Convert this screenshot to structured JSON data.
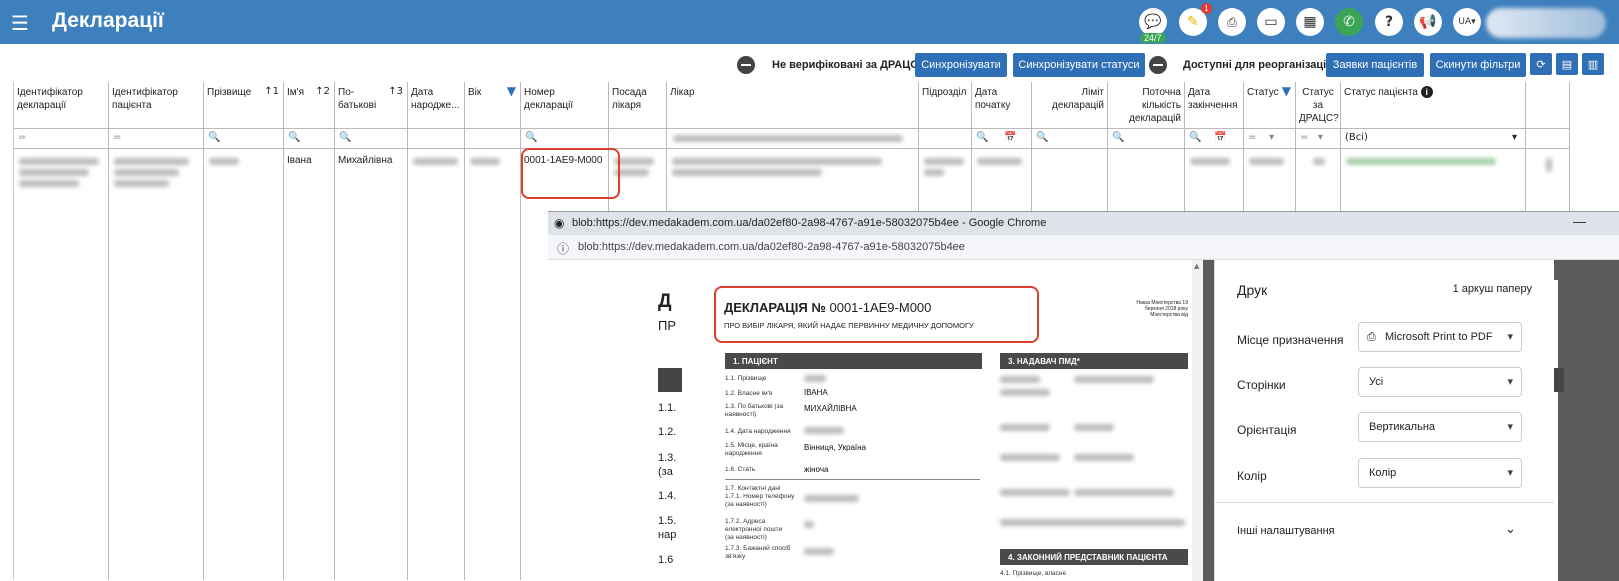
{
  "header": {
    "title": "Декларації",
    "badge_247": "24/7",
    "notif_count": "1",
    "lang": "UA"
  },
  "toolbar": {
    "not_verified_label": "Не верифіковані за ДРАЦС",
    "sync_btn": "Синхронізувати",
    "sync_status_btn": "Синхронізувати статуси",
    "reorg_label": "Доступні для реорганізації",
    "patient_requests_btn": "Заявки пацієнтів",
    "reset_filters_btn": "Скинути фільтри"
  },
  "columns": [
    {
      "label": "Ідентифікатор декларації",
      "filter": "="
    },
    {
      "label": "Ідентифікатор пацієнта",
      "filter": "="
    },
    {
      "label": "Прізвище",
      "sort": "↑1",
      "filter": ""
    },
    {
      "label": "Ім'я",
      "sort": "↑2",
      "filter": ""
    },
    {
      "label": "По-батькові",
      "sort": "↑3",
      "filter": ""
    },
    {
      "label": "Дата народже...",
      "filter": ""
    },
    {
      "label": "Вік",
      "filter": ""
    },
    {
      "label": "Номер декларації",
      "filter": ""
    },
    {
      "label": "Посада лікаря",
      "filter": ""
    },
    {
      "label": "Лікар",
      "filter": ""
    },
    {
      "label": "Підрозділ",
      "filter": ""
    },
    {
      "label": "Дата початку",
      "filter": ""
    },
    {
      "label": "Ліміт декларацій",
      "filter": ""
    },
    {
      "label": "Поточна кількість декларацій",
      "filter": ""
    },
    {
      "label": "Дата закінчення",
      "filter": ""
    },
    {
      "label": "Статус",
      "filter": "="
    },
    {
      "label": "Статус за ДРАЦС?",
      "filter": "="
    },
    {
      "label": "Статус пацієнта",
      "filter": "(Всі)"
    }
  ],
  "row": {
    "first_name": "Івана",
    "patronymic": "Михайлівна",
    "decl_number": "0001-1AE9-M000"
  },
  "browser": {
    "title": "blob:https://dev.medakadem.com.ua/da02ef80-2a98-4767-a91e-58032075b4ee - Google Chrome",
    "address": "blob:https://dev.medakadem.com.ua/da02ef80-2a98-4767-a91e-58032075b4ee"
  },
  "doc": {
    "heading_prefix": "ДЕКЛАРАЦІЯ №",
    "heading_number": "0001-1AE9-M000",
    "subheading": "ПРО ВИБІР ЛІКАРЯ, ЯКИЙ НАДАЄ ПЕРВИННУ МЕДИЧНУ ДОПОМОГУ",
    "order_note": "Наказ Міністерства 19 березня 2018 року Міністерства від",
    "sec1": "1. ПАЦІЄНТ",
    "sec3": "3. НАДАВАЧ ПМД*",
    "sec4": "4. ЗАКОННИЙ ПРЕДСТАВНИК ПАЦІЄНТА",
    "f11": "1.1. Прізвище",
    "f12": "1.2. Власне ім'я",
    "v12": "ІВАНА",
    "f13": "1.3. По батькові (за наявності)",
    "v13": "МИХАЙЛІВНА",
    "f14": "1.4. Дата народження",
    "f15": "1.5. Місце, країна народження",
    "v15": "Вінниця, Україна",
    "f16": "1.6. Стать",
    "v16": "жіноча",
    "f17": "1.7. Контактні дані",
    "f171": "1.7.1. Номер телефону (за наявності)",
    "f172": "1.7.2. Адреса електронної пошти (за наявності)",
    "f173": "1.7.3. Бажаний спосіб зв'язку",
    "f41": "4.1. Прізвище, власне"
  },
  "print": {
    "title": "Друк",
    "sheets": "1 аркуш паперу",
    "dest_label": "Місце призначення",
    "dest_value": "Microsoft Print to PDF",
    "pages_label": "Сторінки",
    "pages_value": "Усі",
    "orient_label": "Орієнтація",
    "orient_value": "Вертикальна",
    "color_label": "Колір",
    "color_value": "Колір",
    "more_label": "Інші налаштування"
  },
  "behind": {
    "d": "Д",
    "pr": "ПР",
    "l1": "1.1.",
    "l2": "1.2.",
    "l3": "1.3.",
    "l3b": "(за",
    "l4": "1.4.",
    "l5": "1.5.",
    "l5b": "нар",
    "l6": "1.6"
  }
}
